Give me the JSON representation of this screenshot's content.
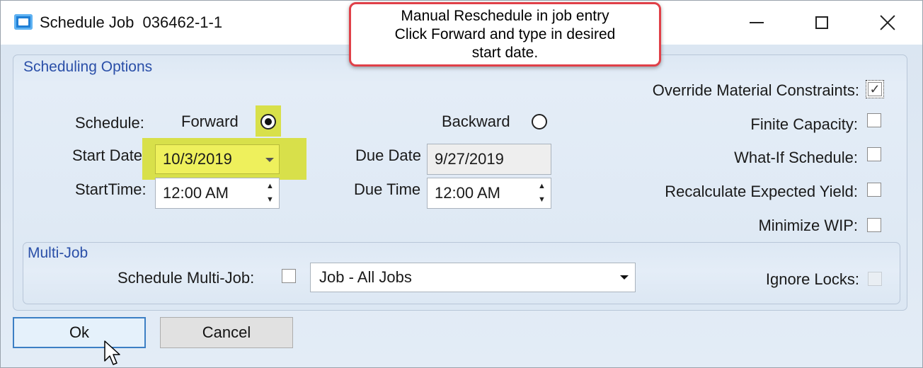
{
  "window": {
    "title": "Schedule Job  036462-1-1"
  },
  "callout": {
    "lines": [
      "Manual Reschedule in job entry",
      "Click Forward and type in desired",
      "start date."
    ]
  },
  "scheduling_options": {
    "group_label": "Scheduling Options",
    "schedule_label": "Schedule:",
    "forward_label": "Forward",
    "backward_label": "Backward",
    "selected": "Forward",
    "start_date_label": "Start Date:",
    "start_date_value": "10/3/2019",
    "start_time_label": "StartTime:",
    "start_time_value": "12:00 AM",
    "due_date_label": "Due Date",
    "due_date_value": "9/27/2019",
    "due_time_label": "Due Time",
    "due_time_value": "12:00 AM",
    "options": [
      {
        "label": "Override Material Constraints:",
        "checked": true
      },
      {
        "label": "Finite Capacity:",
        "checked": false
      },
      {
        "label": "What-If Schedule:",
        "checked": false
      },
      {
        "label": "Recalculate Expected Yield:",
        "checked": false
      },
      {
        "label": "Minimize WIP:",
        "checked": false
      }
    ]
  },
  "multi_job": {
    "group_label": "Multi-Job",
    "schedule_multi_job_label": "Schedule Multi-Job:",
    "schedule_multi_job_checked": false,
    "selected_option": "Job - All Jobs",
    "ignore_locks_label": "Ignore Locks:",
    "ignore_locks_checked": false
  },
  "buttons": {
    "ok": "Ok",
    "cancel": "Cancel"
  },
  "colors": {
    "highlight": "#d8e04a",
    "callout_border": "#e04048",
    "group_label": "#2a4fa8"
  }
}
